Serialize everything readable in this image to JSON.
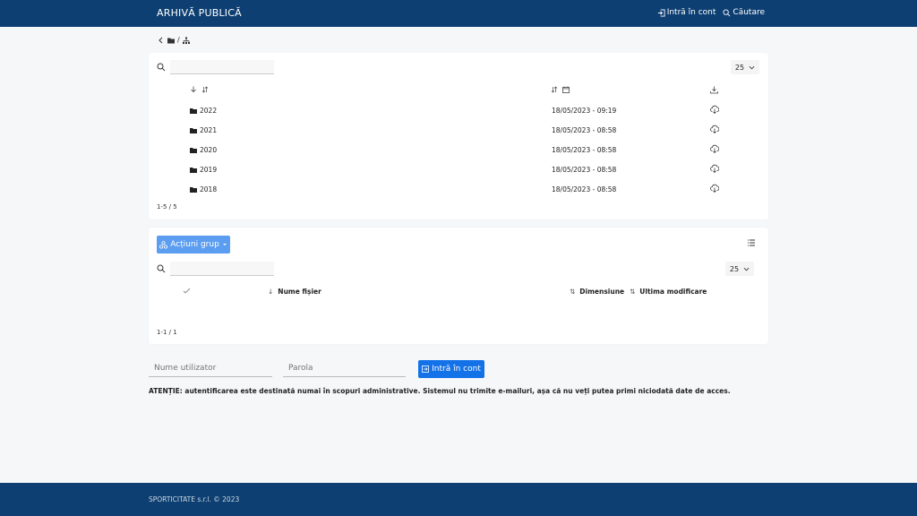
{
  "header": {
    "brand": "ARHIVĂ PUBLICĂ",
    "login_link": "Intră în cont",
    "search_link": "Căutare"
  },
  "folders_panel": {
    "search_value": "",
    "page_size": "25",
    "rows": [
      {
        "name": "2022",
        "modified": "18/05/2023 - 09:19"
      },
      {
        "name": "2021",
        "modified": "18/05/2023 - 08:58"
      },
      {
        "name": "2020",
        "modified": "18/05/2023 - 08:58"
      },
      {
        "name": "2019",
        "modified": "18/05/2023 - 08:58"
      },
      {
        "name": "2018",
        "modified": "18/05/2023 - 08:58"
      }
    ],
    "count": "1-5 / 5"
  },
  "files_panel": {
    "group_actions": "Acțiuni grup",
    "search_value": "",
    "page_size": "25",
    "columns": {
      "name": "Nume fișier",
      "size": "Dimensiune",
      "modified": "Ultima modificare"
    },
    "count": "1-1 / 1"
  },
  "login": {
    "username_placeholder": "Nume utilizator",
    "password_placeholder": "Parola",
    "button": "Intră în cont"
  },
  "warning": "ATENȚIE: autentificarea este destinată numai în scopuri administrative. Sistemul nu trimite e-mailuri, așa că nu veți putea primi niciodată date de acces.",
  "footer": "SPORTICITATE s.r.l. © 2023",
  "colors": {
    "navbar": "#0d3f72",
    "primary_button": "#1472e8",
    "group_button": "#5b9df0"
  }
}
